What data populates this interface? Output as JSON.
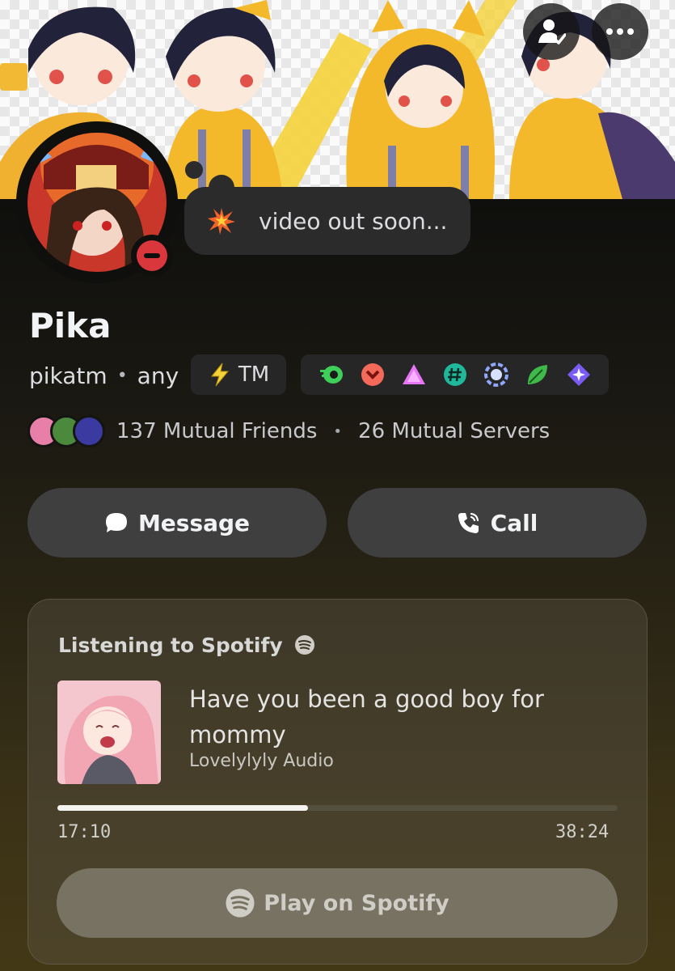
{
  "profile": {
    "display_name": "Pika",
    "username": "pikatm",
    "separator": "•",
    "pronouns": "any",
    "status": "do-not-disturb",
    "custom_status": {
      "emoji": "collision-emoji",
      "text": "video out soon..."
    },
    "server_tag": {
      "icon": "lightning-icon",
      "text": "TM"
    },
    "badges": [
      "nitro-badge",
      "boost-badge",
      "hypesquad-badge",
      "hashtag-badge",
      "laurel-badge",
      "leaf-badge",
      "quest-badge"
    ]
  },
  "header": {
    "icons": [
      "friends-check-icon",
      "more-options-icon"
    ]
  },
  "mutuals": {
    "friends": "137 Mutual Friends",
    "separator": "•",
    "servers": "26 Mutual Servers"
  },
  "actions": {
    "message_label": "Message",
    "call_label": "Call"
  },
  "activity": {
    "header": "Listening to Spotify",
    "track_title": "Have you been a good boy for mommy",
    "artist": "Lovelylyly Audio",
    "elapsed": "17:10",
    "duration": "38:24",
    "progress": 0.447,
    "play_label": "Play on Spotify"
  },
  "colors": {
    "dnd": "#da373c",
    "button": "#3f3f3f",
    "banner_yellow": "#f4b92a"
  }
}
